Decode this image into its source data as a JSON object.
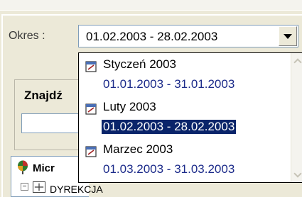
{
  "okres": {
    "label": "Okres :",
    "value": "01.02.2003 - 28.02.2003"
  },
  "search": {
    "label": "Znajdź"
  },
  "tree": {
    "root_label": "Micr",
    "node_label": "DYREKCJA",
    "expander": "−"
  },
  "dropdown": {
    "items": [
      {
        "name": "Styczeń 2003",
        "range": "01.01.2003 - 31.01.2003",
        "selected": false
      },
      {
        "name": "Luty 2003",
        "range": "01.02.2003 - 28.02.2003",
        "selected": true
      },
      {
        "name": "Marzec 2003",
        "range": "01.03.2003 - 31.03.2003",
        "selected": false
      }
    ]
  },
  "colors": {
    "selection": "#0a246a",
    "range_text": "#1c2b8a"
  }
}
